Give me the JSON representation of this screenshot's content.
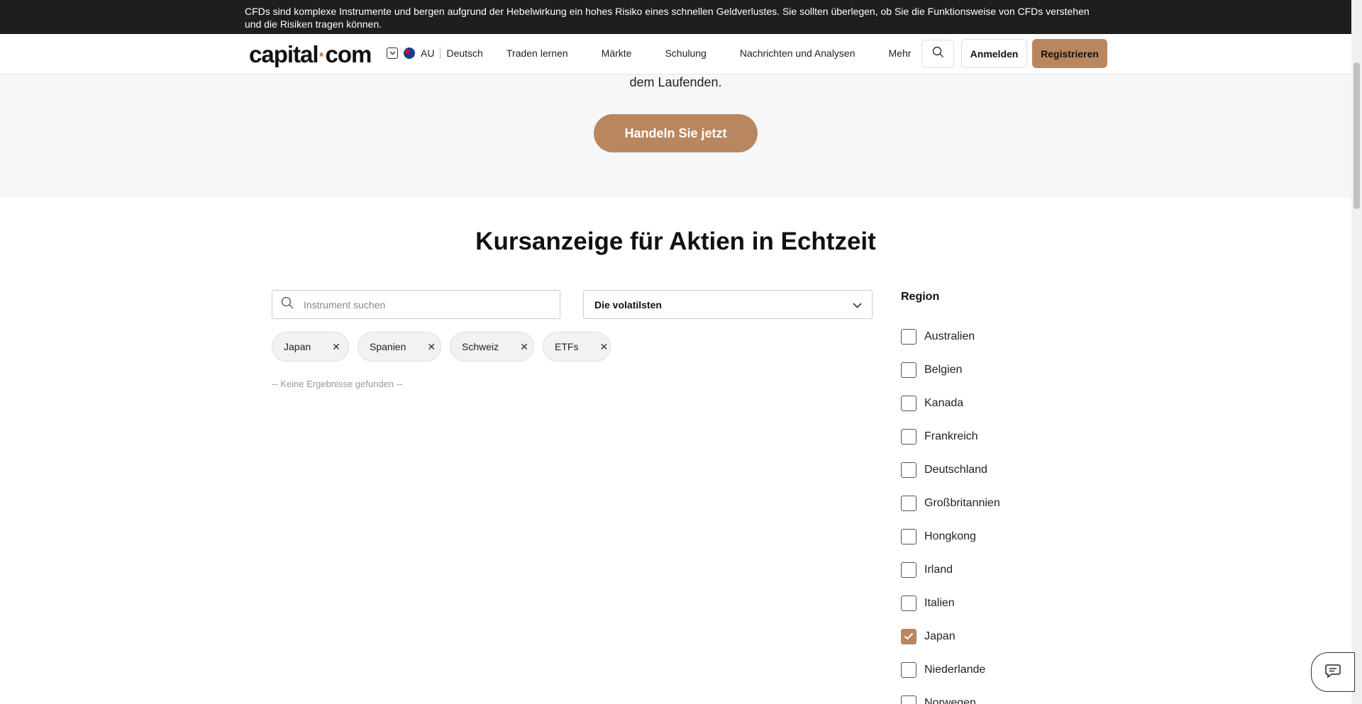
{
  "risk_banner": {
    "text": "CFDs sind komplexe Instrumente und bergen aufgrund der Hebelwirkung ein hohes Risiko eines schnellen Geldverlustes. Sie sollten überlegen, ob Sie die Funktionsweise von CFDs verstehen und die Risiken tragen können."
  },
  "header": {
    "logo_main": "capital",
    "logo_dot": "·",
    "logo_tail": "com",
    "region_code": "AU",
    "language": "Deutsch",
    "menu": [
      "Traden lernen",
      "Märkte",
      "Schulung",
      "Nachrichten und Analysen",
      "Mehr"
    ],
    "login_label": "Anmelden",
    "register_label": "Registrieren"
  },
  "hero": {
    "text": "dem Laufenden.",
    "cta_label": "Handeln Sie jetzt"
  },
  "section": {
    "title": "Kursanzeige für Aktien in Echtzeit"
  },
  "filters": {
    "search_placeholder": "Instrument suchen",
    "search_value": "",
    "sort_selected": "Die volatilsten",
    "chips": [
      "Japan",
      "Spanien",
      "Schweiz",
      "ETFs"
    ],
    "no_results": "-- Keine Ergebnisse gefunden --"
  },
  "region": {
    "title": "Region",
    "items": [
      {
        "label": "Australien",
        "checked": false
      },
      {
        "label": "Belgien",
        "checked": false
      },
      {
        "label": "Kanada",
        "checked": false
      },
      {
        "label": "Frankreich",
        "checked": false
      },
      {
        "label": "Deutschland",
        "checked": false
      },
      {
        "label": "Großbritannien",
        "checked": false
      },
      {
        "label": "Hongkong",
        "checked": false
      },
      {
        "label": "Irland",
        "checked": false
      },
      {
        "label": "Italien",
        "checked": false
      },
      {
        "label": "Japan",
        "checked": true
      },
      {
        "label": "Niederlande",
        "checked": false
      },
      {
        "label": "Norwegen",
        "checked": false
      }
    ]
  },
  "colors": {
    "brand": "#b9875f",
    "banner_bg": "#1e1e1e"
  },
  "icons": {
    "search": "search-icon",
    "chevron": "chevron-down-icon",
    "close": "close-icon",
    "check": "check-icon",
    "chat": "chat-icon",
    "flag": "australia-flag-icon"
  }
}
